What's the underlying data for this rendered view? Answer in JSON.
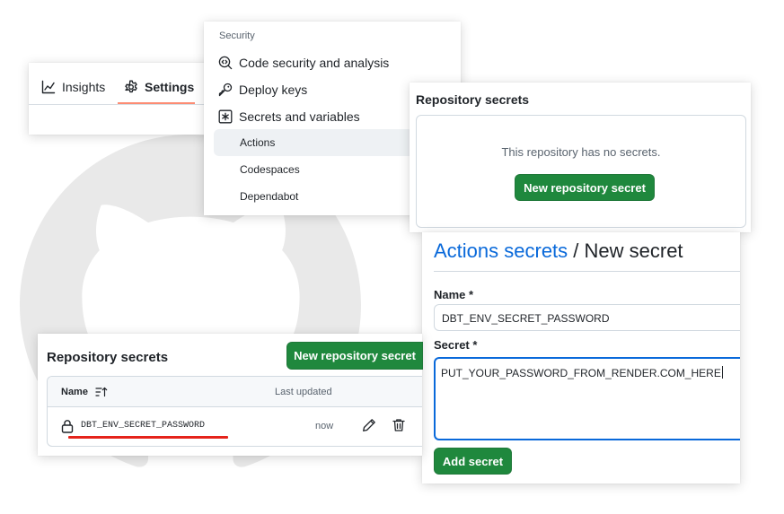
{
  "tabs": {
    "insights_label": "Insights",
    "settings_label": "Settings"
  },
  "security_menu": {
    "heading": "Security",
    "items": [
      {
        "label": "Code security and analysis",
        "icon": "codescan-icon"
      },
      {
        "label": "Deploy keys",
        "icon": "key-icon"
      },
      {
        "label": "Secrets and variables",
        "icon": "asterisk-icon"
      }
    ],
    "sub_items": [
      {
        "label": "Actions",
        "active": true
      },
      {
        "label": "Codespaces",
        "active": false
      },
      {
        "label": "Dependabot",
        "active": false
      }
    ]
  },
  "empty_secrets": {
    "title": "Repository secrets",
    "message": "This repository has no secrets.",
    "button_label": "New repository secret"
  },
  "new_secret_form": {
    "breadcrumb_link": "Actions secrets",
    "breadcrumb_separator": " / ",
    "breadcrumb_current": "New secret",
    "name_label": "Name *",
    "name_value": "DBT_ENV_SECRET_PASSWORD",
    "secret_label": "Secret *",
    "secret_value": "PUT_YOUR_PASSWORD_FROM_RENDER.COM_HERE",
    "submit_label": "Add secret"
  },
  "secrets_list": {
    "title": "Repository secrets",
    "button_label": "New repository secret",
    "columns": {
      "name": "Name",
      "last_updated": "Last updated"
    },
    "rows": [
      {
        "name": "DBT_ENV_SECRET_PASSWORD",
        "last_updated": "now"
      }
    ]
  },
  "colors": {
    "primary_green": "#1f883d",
    "link_blue": "#0969da",
    "tab_underline": "#fd8c73",
    "highlight_red": "#e5231b"
  }
}
